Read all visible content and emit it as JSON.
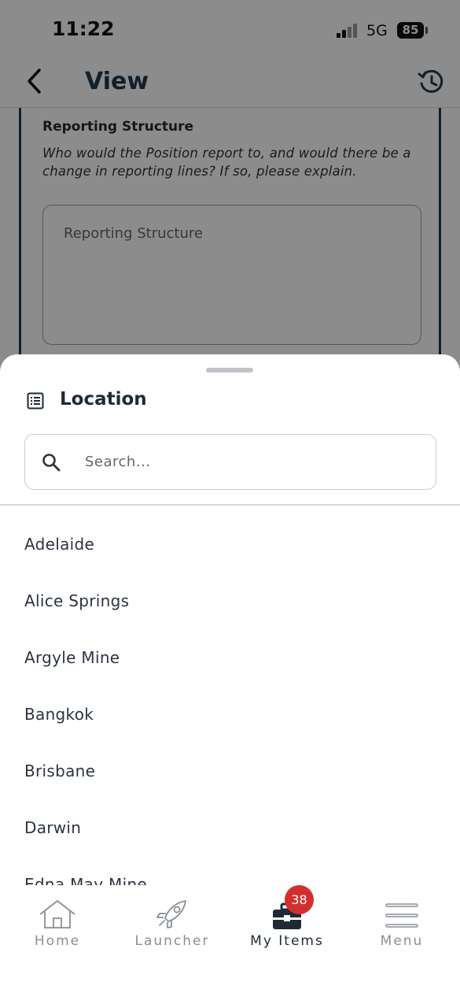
{
  "status_bar": {
    "time": "11:22",
    "network": "5G",
    "battery": "85"
  },
  "header": {
    "title": "View"
  },
  "form": {
    "label": "Reporting Structure",
    "help": "Who would the Position report to, and would there be a change in reporting lines? If so, please explain.",
    "placeholder": "Reporting Structure"
  },
  "sheet": {
    "title": "Location",
    "search_placeholder": "Search...",
    "items": [
      "Adelaide",
      "Alice Springs",
      "Argyle Mine",
      "Bangkok",
      "Brisbane",
      "Darwin",
      "Edna May Mine"
    ]
  },
  "tab_bar": {
    "tabs": [
      {
        "label": "Home",
        "icon": "home-icon"
      },
      {
        "label": "Launcher",
        "icon": "rocket-icon"
      },
      {
        "label": "My Items",
        "icon": "briefcase-icon"
      },
      {
        "label": "Menu",
        "icon": "hamburger-icon"
      }
    ],
    "active": "My Items",
    "badge": "38"
  },
  "colors": {
    "accent": "#24394b",
    "badge": "#d32f2f"
  }
}
